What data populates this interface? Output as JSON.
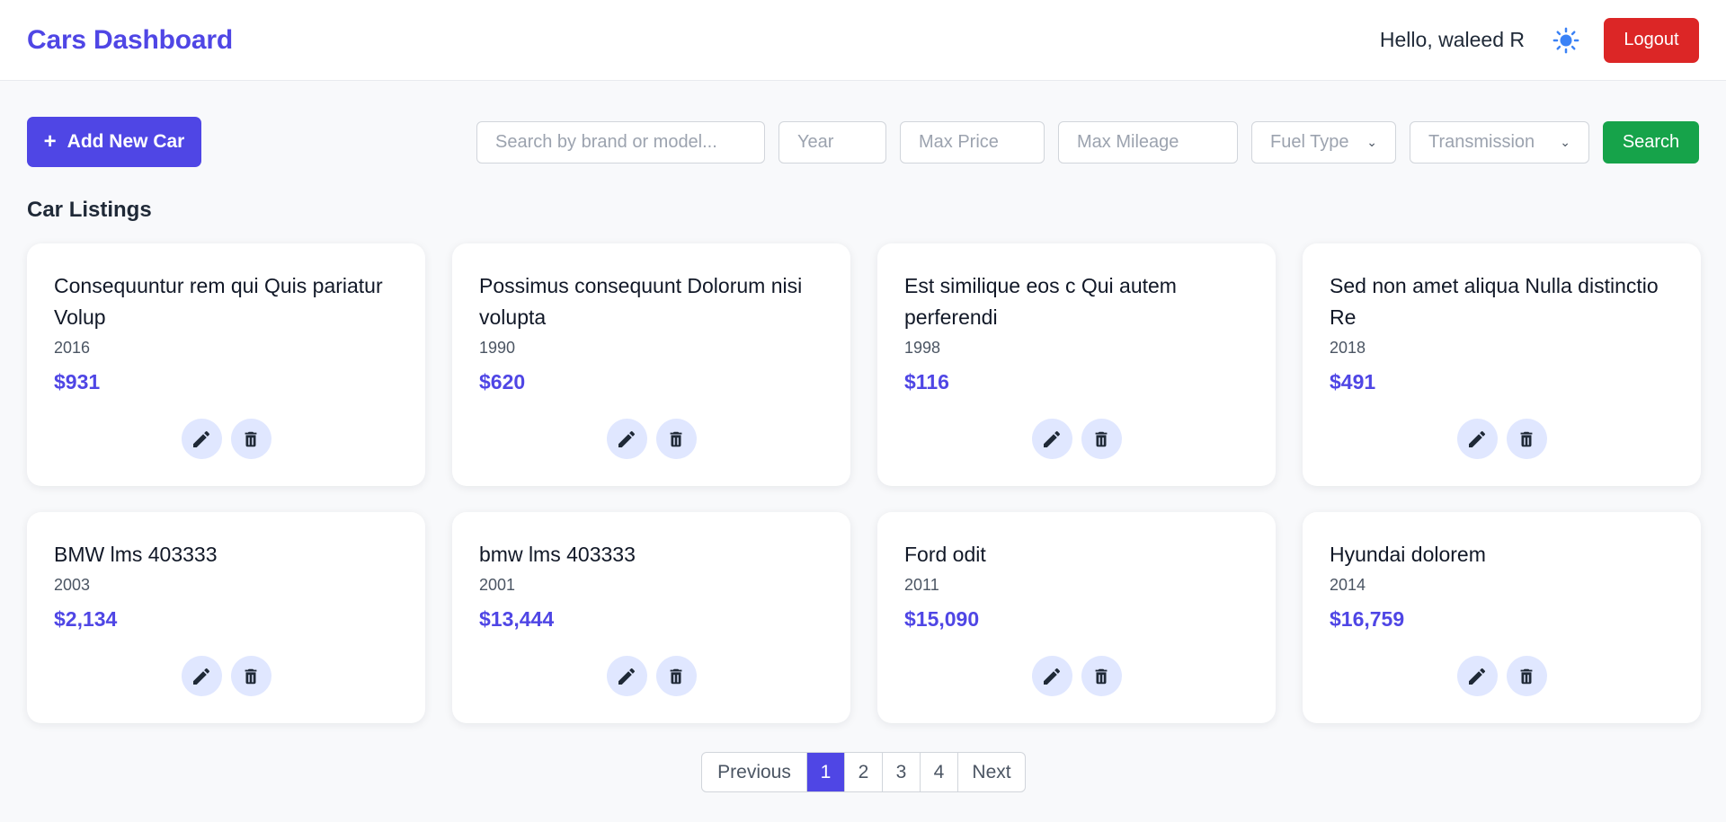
{
  "header": {
    "brand": "Cars Dashboard",
    "greeting": "Hello, waleed R",
    "logout_label": "Logout"
  },
  "toolbar": {
    "add_label": "Add New Car",
    "search_placeholder": "Search by brand or model...",
    "year_placeholder": "Year",
    "max_price_placeholder": "Max Price",
    "max_mileage_placeholder": "Max Mileage",
    "fuel_type_label": "Fuel Type",
    "transmission_label": "Transmission",
    "search_label": "Search"
  },
  "listings": {
    "title": "Car Listings",
    "cards": [
      {
        "title": "Consequuntur rem qui Quis pariatur Volup",
        "year": "2016",
        "price": "$931"
      },
      {
        "title": "Possimus consequunt Dolorum nisi volupta",
        "year": "1990",
        "price": "$620"
      },
      {
        "title": "Est similique eos c Qui autem perferendi",
        "year": "1998",
        "price": "$116"
      },
      {
        "title": "Sed non amet aliqua Nulla distinctio Re",
        "year": "2018",
        "price": "$491"
      },
      {
        "title": "BMW lms 403333",
        "year": "2003",
        "price": "$2,134"
      },
      {
        "title": "bmw lms 403333",
        "year": "2001",
        "price": "$13,444"
      },
      {
        "title": "Ford odit",
        "year": "2011",
        "price": "$15,090"
      },
      {
        "title": "Hyundai dolorem",
        "year": "2014",
        "price": "$16,759"
      }
    ]
  },
  "pagination": {
    "previous": "Previous",
    "pages": [
      "1",
      "2",
      "3",
      "4"
    ],
    "current": "1",
    "next": "Next"
  },
  "icons": {
    "theme": "sun-icon",
    "edit": "pencil-icon",
    "delete": "trash-icon"
  },
  "colors": {
    "brand": "#4f46e5",
    "logout": "#dc2626",
    "search": "#16a34a",
    "icon_button_bg": "#e0e7ff"
  }
}
